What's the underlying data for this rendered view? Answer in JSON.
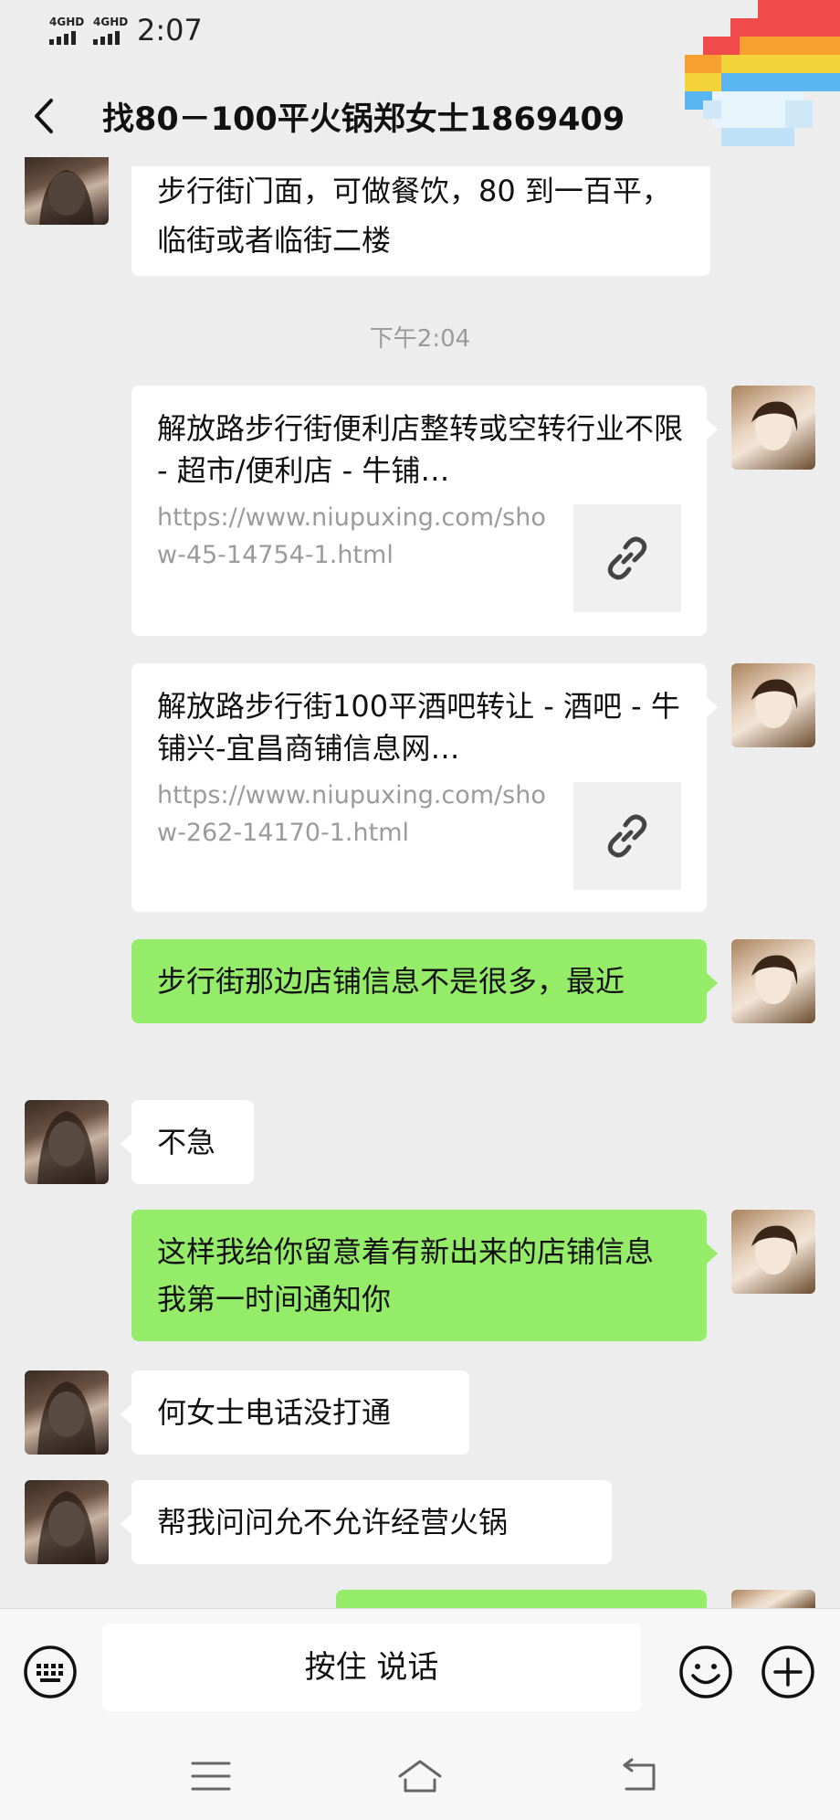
{
  "status_bar": {
    "signal1": "4GHD",
    "signal2": "4GHD",
    "time": "2:07"
  },
  "header": {
    "title": "找80－100平火锅郑女士1869409"
  },
  "messages": {
    "m0_text": "步行街门面，可做餐饮，80 到一百平，临街或者临街二楼",
    "timestamp": "下午2:04",
    "link1": {
      "title": "解放路步行街便利店整转或空转行业不限 - 超市/便利店 - 牛铺…",
      "url": "https://www.niupuxing.com/show-45-14754-1.html"
    },
    "link2": {
      "title": "解放路步行街100平酒吧转让 - 酒吧 - 牛铺兴-宜昌商铺信息网…",
      "url": "https://www.niupuxing.com/show-262-14170-1.html"
    },
    "m3_text": "步行街那边店铺信息不是很多，最近",
    "m4_text": "不急",
    "m5_text": "这样我给你留意着有新出来的店铺信息我第一时间通知你",
    "m6_text": "何女士电话没打通",
    "m7_text": "帮我问问允不允许经营火锅"
  },
  "input_bar": {
    "voice_label": "按住 说话"
  },
  "icons": {
    "back": "back-arrow-icon",
    "keyboard": "keyboard-icon",
    "emoji": "emoji-icon",
    "plus": "plus-icon",
    "link": "link-icon",
    "menu": "menu-icon",
    "home": "home-icon",
    "return": "return-icon"
  },
  "colors": {
    "background": "#ededed",
    "my_bubble": "#95ec69",
    "other_bubble": "#ffffff",
    "timestamp": "#9a9a9a"
  }
}
